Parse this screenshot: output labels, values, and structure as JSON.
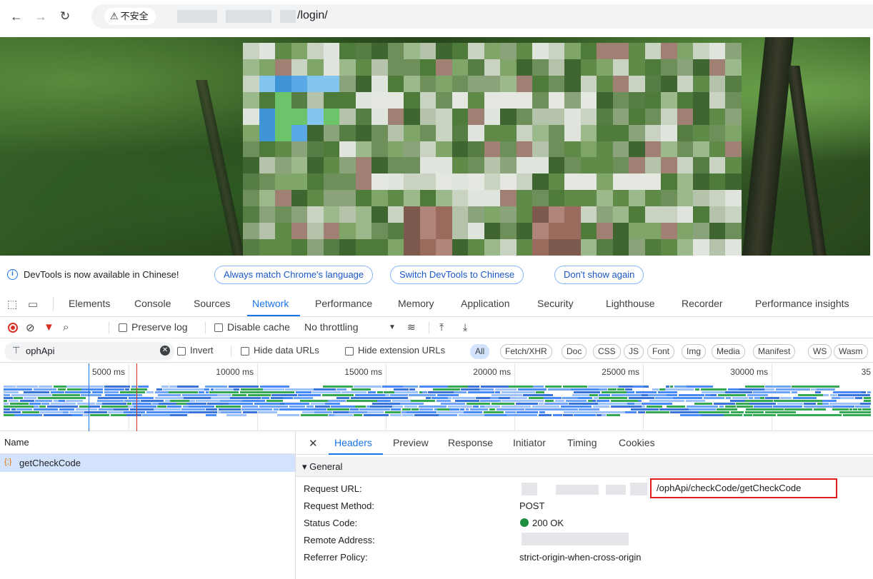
{
  "browser": {
    "security_label": "不安全",
    "url_path": "/login/"
  },
  "infobar": {
    "message": "DevTools is now available in Chinese!",
    "buttons": [
      "Always match Chrome's language",
      "Switch DevTools to Chinese",
      "Don't show again"
    ]
  },
  "devtools_tabs": [
    "Elements",
    "Console",
    "Sources",
    "Network",
    "Performance",
    "Memory",
    "Application",
    "Security",
    "Lighthouse",
    "Recorder",
    "Performance insights"
  ],
  "active_tab": "Network",
  "network_toolbar": {
    "preserve_log": "Preserve log",
    "disable_cache": "Disable cache",
    "throttling": "No throttling"
  },
  "filter": {
    "value": "ophApi",
    "invert": "Invert",
    "hide_data_urls": "Hide data URLs",
    "hide_extension_urls": "Hide extension URLs",
    "type_chips": [
      "All",
      "Fetch/XHR",
      "Doc",
      "CSS",
      "JS",
      "Font",
      "Img",
      "Media",
      "Manifest",
      "WS",
      "Wasm"
    ],
    "active_chip": "All"
  },
  "timeline": {
    "ticks": [
      "5000 ms",
      "10000 ms",
      "15000 ms",
      "20000 ms",
      "25000 ms",
      "30000 ms",
      "35"
    ]
  },
  "request_list": {
    "column": "Name",
    "rows": [
      {
        "name": "getCheckCode",
        "selected": true
      }
    ]
  },
  "detail_tabs": [
    "Headers",
    "Preview",
    "Response",
    "Initiator",
    "Timing",
    "Cookies"
  ],
  "active_detail_tab": "Headers",
  "general": {
    "section_title": "▾ General",
    "rows": [
      {
        "key": "Request URL:",
        "value": "/ophApi/checkCode/getCheckCode"
      },
      {
        "key": "Request Method:",
        "value": "POST"
      },
      {
        "key": "Status Code:",
        "value": "200 OK"
      },
      {
        "key": "Remote Address:",
        "value": ""
      },
      {
        "key": "Referrer Policy:",
        "value": "strict-origin-when-cross-origin"
      }
    ]
  },
  "colors": {
    "accent": "#1a73e8",
    "record": "#d93025",
    "status_ok": "#1e8e3e",
    "highlight_box": "#e11c1c"
  }
}
